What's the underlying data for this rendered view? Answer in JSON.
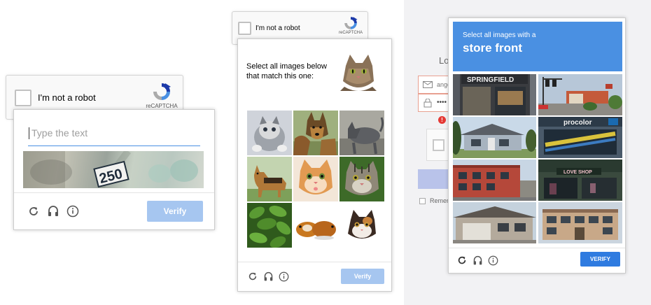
{
  "left": {
    "anchor_label": "I'm not a robot",
    "brand": "reCAPTCHA",
    "input_placeholder": "Type the text",
    "captcha_text": "250",
    "verify_label": "Verify"
  },
  "middle": {
    "anchor_label": "I'm not a robot",
    "brand": "reCAPTCHA",
    "instruction": "Select all images below that match this one:",
    "verify_label": "Verify",
    "tiles": [
      "kitten",
      "german-shepherd",
      "grey-cat",
      "german-shepherd-standing",
      "orange-kitten",
      "tabby-kitten",
      "green-plant",
      "guinea-pigs",
      "calico-kitten"
    ]
  },
  "right": {
    "instruction_small": "Select all images with a",
    "instruction_big": "store front",
    "verify_label": "VERIFY",
    "bg_form": {
      "title_fragment": "Lo",
      "email_fragment": "ange",
      "password_fragment": "••••",
      "remember_fragment": "Remen"
    },
    "tiles": [
      {
        "name": "springfield-store",
        "sign": "SPRINGFIELD"
      },
      {
        "name": "street-intersection",
        "sign": ""
      },
      {
        "name": "suburban-house",
        "sign": ""
      },
      {
        "name": "procolor-store",
        "sign": "procolor"
      },
      {
        "name": "red-brick-building",
        "sign": ""
      },
      {
        "name": "love-shop-store",
        "sign": "LOVE SHOP"
      },
      {
        "name": "garage-house",
        "sign": ""
      },
      {
        "name": "office-building",
        "sign": ""
      }
    ]
  },
  "colors": {
    "accent": "#4a90e2",
    "verify_disabled": "#a6c6f0",
    "verify_active": "#1a73e8",
    "error": "#e53935"
  }
}
